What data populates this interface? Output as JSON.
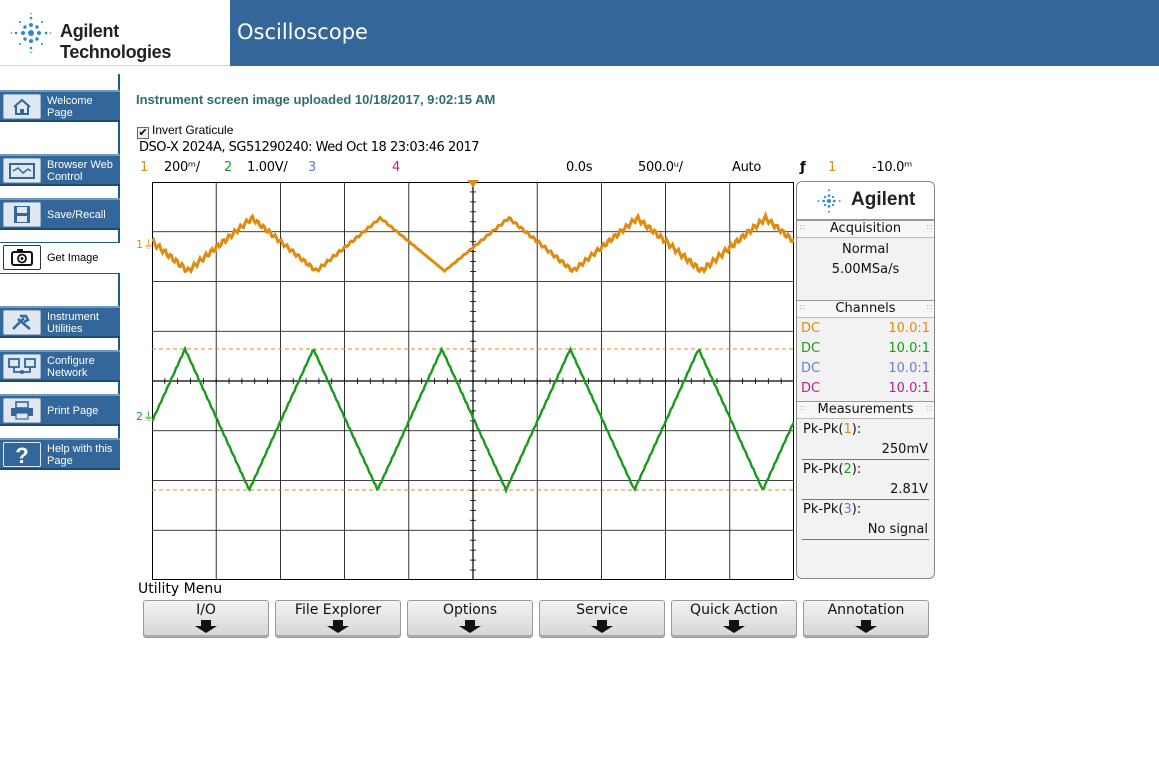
{
  "header": {
    "brand": "Agilent Technologies",
    "title": "Oscilloscope"
  },
  "sidebar": {
    "items": [
      {
        "label": "Welcome Page",
        "icon": "home-icon",
        "active": false
      },
      {
        "label": "Browser Web Control",
        "icon": "browser-control-icon",
        "active": false
      },
      {
        "label": "Save/Recall",
        "icon": "floppy-disk-icon",
        "active": false
      },
      {
        "label": "Get Image",
        "icon": "camera-icon",
        "active": true
      },
      {
        "label": "Instrument Utilities",
        "icon": "tools-icon",
        "active": false
      },
      {
        "label": "Configure Network",
        "icon": "network-icon",
        "active": false
      },
      {
        "label": "Print Page",
        "icon": "printer-icon",
        "active": false
      },
      {
        "label": "Help with this Page",
        "icon": "help-icon",
        "active": false
      }
    ]
  },
  "main": {
    "upload_title": "Instrument screen image uploaded  10/18/2017, 9:02:15 AM",
    "invert_label": "Invert Graticule",
    "invert_checked": true
  },
  "scope": {
    "info_line": "DSO-X 2024A, SG51290240: Wed Oct 18 23:03:46 2017",
    "channels_bar": [
      {
        "num": "1",
        "scale": "200ᵐ/",
        "color": "#e08a10"
      },
      {
        "num": "2",
        "scale": "1.00V/",
        "color": "#1a9a1a"
      },
      {
        "num": "3",
        "scale": "",
        "color": "#6a7bd8"
      },
      {
        "num": "4",
        "scale": "",
        "color": "#c0208a"
      }
    ],
    "time_offset": "0.0s",
    "time_scale": "500.0ᵘ/",
    "trigger_mode": "Auto",
    "trigger_channel": "1",
    "trigger_level": "-10.0ᵐ",
    "ch1_marker": "1",
    "ch2_marker": "2",
    "colors": {
      "ch1": "#e08a10",
      "ch2": "#1a9a1a",
      "ch3": "#6a7bd8",
      "ch4": "#c0208a",
      "cursor": "#e08a10",
      "grid": "#000000"
    }
  },
  "panel": {
    "brand": "Agilent",
    "acquisition_title": "Acquisition",
    "acq_mode": "Normal",
    "acq_rate": "5.00MSa/s",
    "channels_title": "Channels",
    "channels": [
      {
        "coupling": "DC",
        "probe": "10.0:1",
        "color": "#e08a10"
      },
      {
        "coupling": "DC",
        "probe": "10.0:1",
        "color": "#1a9a1a"
      },
      {
        "coupling": "DC",
        "probe": "10.0:1",
        "color": "#6a7bd8"
      },
      {
        "coupling": "DC",
        "probe": "10.0:1",
        "color": "#c0208a"
      }
    ],
    "measurements_title": "Measurements",
    "measurements": [
      {
        "prefix": "Pk-Pk(",
        "ch": "1",
        "suffix": "):",
        "value": "250mV",
        "color": "#e08a10"
      },
      {
        "prefix": "Pk-Pk(",
        "ch": "2",
        "suffix": "):",
        "value": "2.81V",
        "color": "#1a9a1a"
      },
      {
        "prefix": "Pk-Pk(",
        "ch": "3",
        "suffix": "):",
        "value": "No signal",
        "color": "#6a7bd8"
      }
    ]
  },
  "utility": {
    "title": "Utility Menu",
    "softkeys": [
      "I/O",
      "File Explorer",
      "Options",
      "Service",
      "Quick Action",
      "Annotation"
    ]
  }
}
